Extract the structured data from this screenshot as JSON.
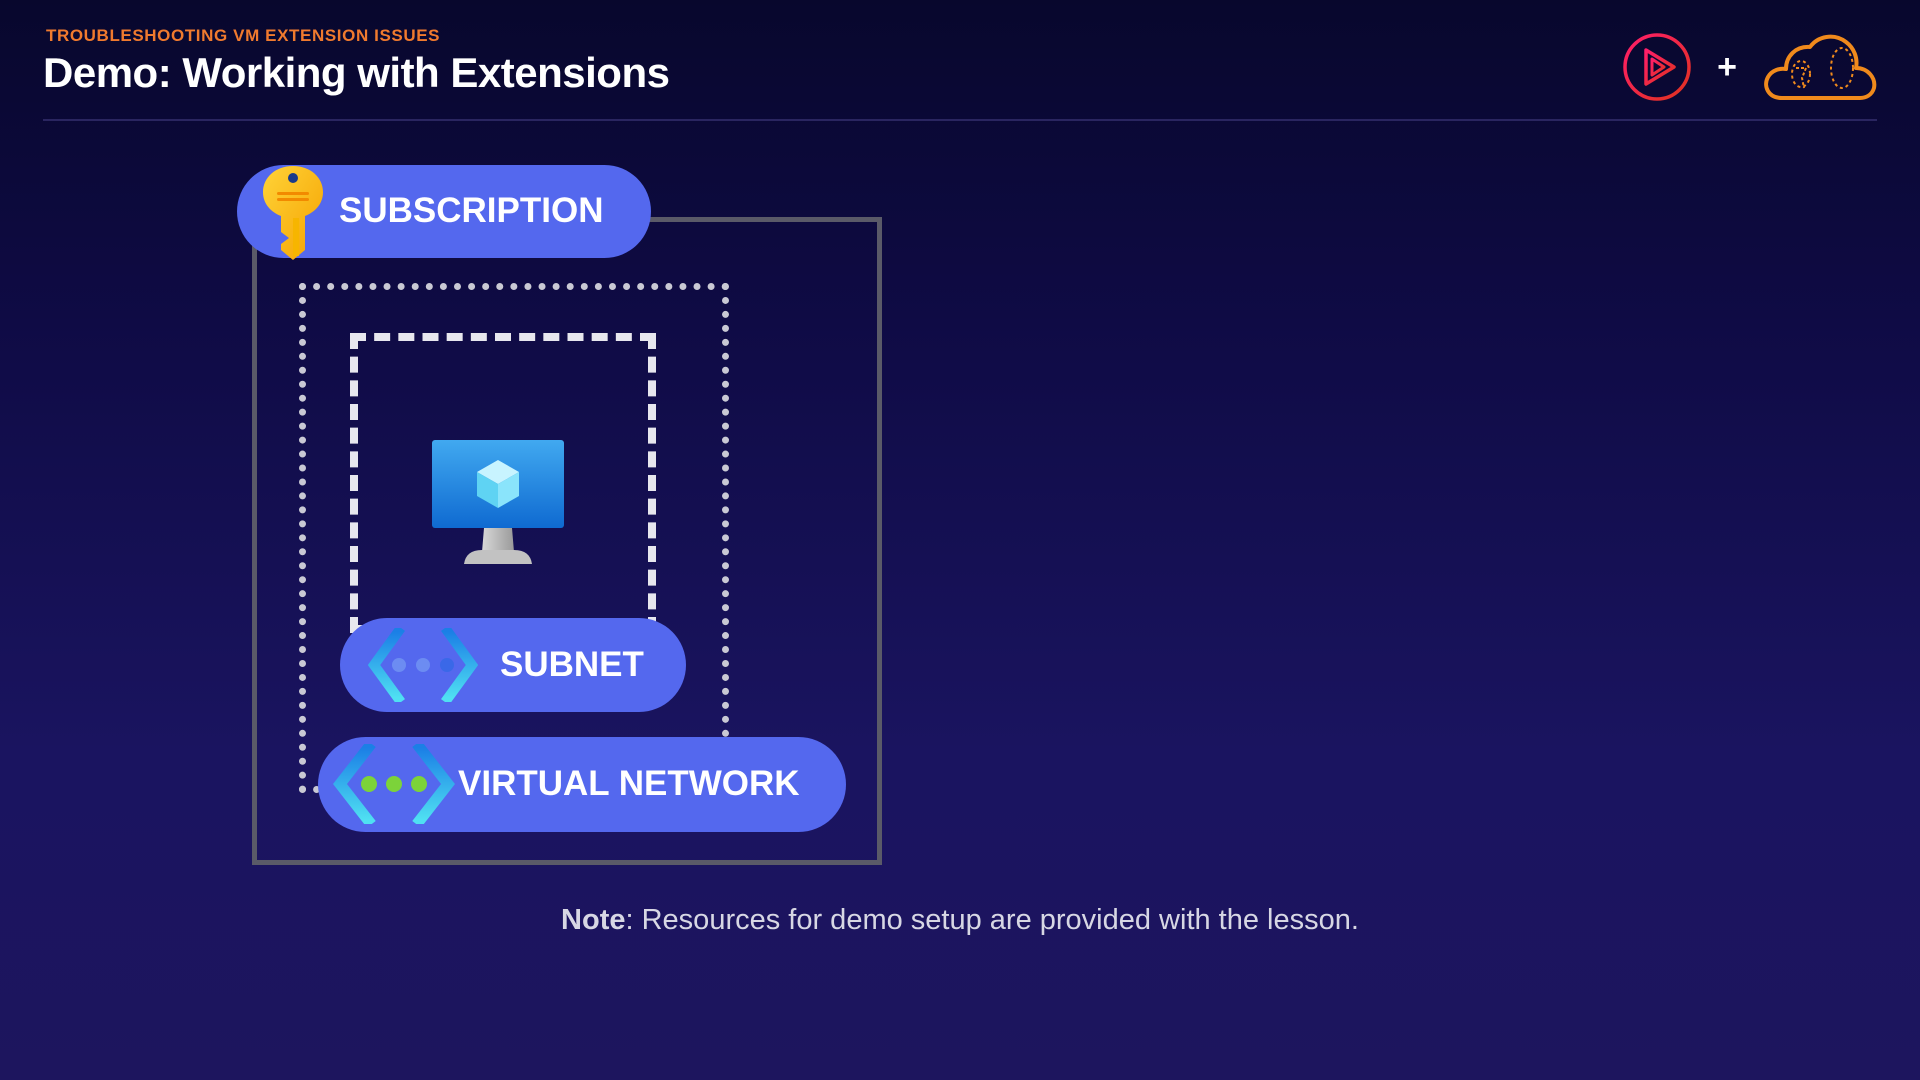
{
  "header": {
    "kicker": "TROUBLESHOOTING VM EXTENSION ISSUES",
    "title": "Demo: Working with Extensions",
    "plus": "+"
  },
  "diagram": {
    "subscription_label": "SUBSCRIPTION",
    "subnet_label": "SUBNET",
    "vnet_label": "VIRTUAL NETWORK"
  },
  "note": {
    "label": "Note",
    "text": ": Resources for demo setup are provided with the lesson."
  },
  "icons": {
    "brand_play": "play-logo-icon",
    "brand_cloud": "cloud-logo-icon",
    "key": "key-icon",
    "vm": "virtual-machine-icon",
    "subnet": "subnet-icon",
    "vnet": "virtual-network-icon"
  },
  "colors": {
    "accent_orange": "#f07a2e",
    "pill_blue": "#5468ee",
    "brand_pink": "#e6245e"
  }
}
